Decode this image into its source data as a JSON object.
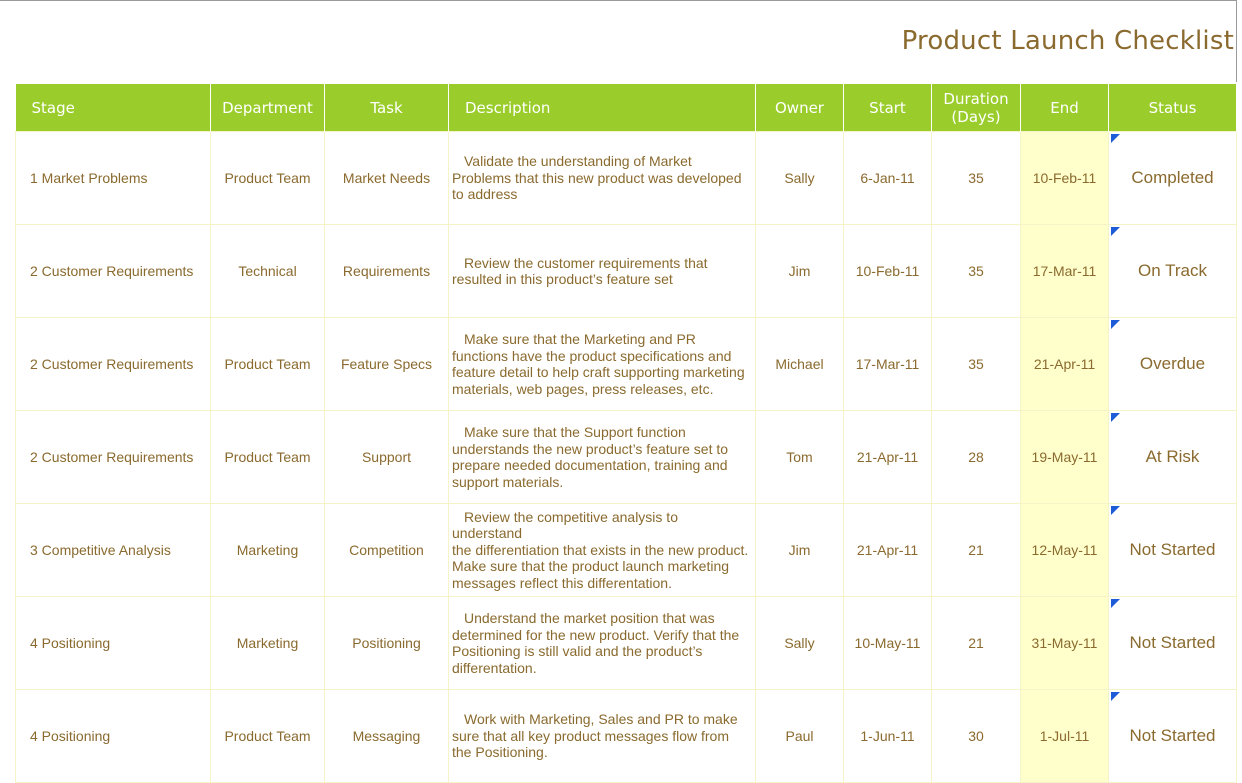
{
  "title": "Product Launch Checklist",
  "colors": {
    "header_bg": "#9acd2b",
    "text": "#8a6a2e",
    "end_column_bg": "#ffffcc",
    "flag": "#1e5bd6"
  },
  "headers": {
    "stage": "Stage",
    "department": "Department",
    "task": "Task",
    "description": "Description",
    "owner": "Owner",
    "start": "Start",
    "duration_line1": "Duration",
    "duration_line2": "(Days)",
    "end": "End",
    "status": "Status"
  },
  "rows": [
    {
      "stage": "1 Market Problems",
      "department": "Product Team",
      "task": "Market Needs",
      "description_first": "Validate the understanding of Market",
      "description_rest": [
        "Problems that this new product was developed",
        "to address"
      ],
      "owner": "Sally",
      "start": "6-Jan-11",
      "duration": "35",
      "end": "10-Feb-11",
      "status": "Completed"
    },
    {
      "stage": "2 Customer Requirements",
      "department": "Technical",
      "task": "Requirements",
      "description_first": "Review the customer requirements that",
      "description_rest": [
        "resulted in this product’s feature set"
      ],
      "owner": "Jim",
      "start": "10-Feb-11",
      "duration": "35",
      "end": "17-Mar-11",
      "status": "On Track"
    },
    {
      "stage": "2 Customer Requirements",
      "department": "Product Team",
      "task": "Feature Specs",
      "description_first": "Make sure that the Marketing and PR",
      "description_rest": [
        "functions have the product specifications and",
        "feature detail to help craft supporting marketing",
        "materials, web pages, press releases, etc."
      ],
      "owner": "Michael",
      "start": "17-Mar-11",
      "duration": "35",
      "end": "21-Apr-11",
      "status": "Overdue"
    },
    {
      "stage": "2 Customer Requirements",
      "department": "Product Team",
      "task": "Support",
      "description_first": "Make sure that the Support function",
      "description_rest": [
        "understands the new product’s feature set to",
        "prepare needed documentation, training and",
        "support materials."
      ],
      "owner": "Tom",
      "start": "21-Apr-11",
      "duration": "28",
      "end": "19-May-11",
      "status": "At Risk"
    },
    {
      "stage": "3 Competitive Analysis",
      "department": "Marketing",
      "task": "Competition",
      "description_first": "Review the competitive analysis to understand",
      "description_rest": [
        "the differentiation that exists in the new product.",
        "Make sure that the product launch marketing",
        "messages reflect this differentation."
      ],
      "owner": "Jim",
      "start": "21-Apr-11",
      "duration": "21",
      "end": "12-May-11",
      "status": "Not Started"
    },
    {
      "stage": "4 Positioning",
      "department": "Marketing",
      "task": "Positioning",
      "description_first": "Understand the market position that was",
      "description_rest": [
        "determined for the new product.  Verify that the",
        "Positioning is still valid and the product’s",
        "differentation."
      ],
      "owner": "Sally",
      "start": "10-May-11",
      "duration": "21",
      "end": "31-May-11",
      "status": "Not Started"
    },
    {
      "stage": "4 Positioning",
      "department": "Product Team",
      "task": "Messaging",
      "description_first": "Work with Marketing, Sales and PR to make",
      "description_rest": [
        "sure that all key product messages flow from",
        "the Positioning."
      ],
      "owner": "Paul",
      "start": "1-Jun-11",
      "duration": "30",
      "end": "1-Jul-11",
      "status": "Not Started"
    }
  ]
}
